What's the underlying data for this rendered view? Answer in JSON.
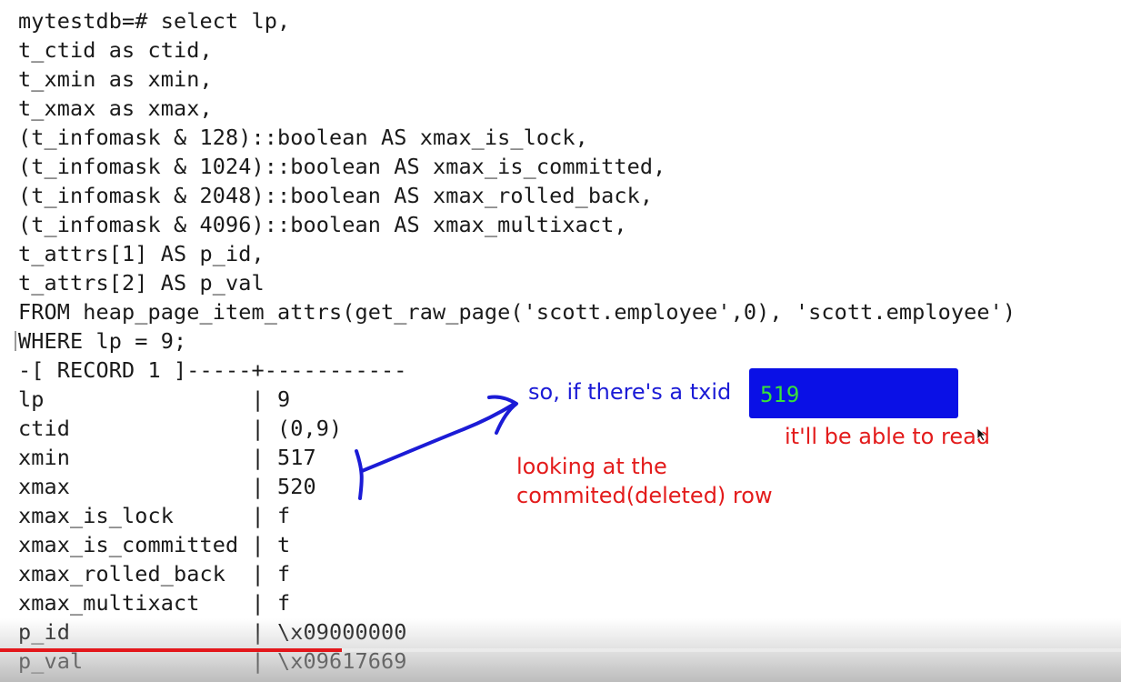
{
  "terminal": {
    "lines": [
      "mytestdb=# select lp,",
      "t_ctid as ctid,",
      "t_xmin as xmin,",
      "t_xmax as xmax,",
      "(t_infomask & 128)::boolean AS xmax_is_lock,",
      "(t_infomask & 1024)::boolean AS xmax_is_committed,",
      "(t_infomask & 2048)::boolean AS xmax_rolled_back,",
      "(t_infomask & 4096)::boolean AS xmax_multixact,",
      "t_attrs[1] AS p_id,",
      "t_attrs[2] AS p_val",
      "FROM heap_page_item_attrs(get_raw_page('scott.employee',0), 'scott.employee')",
      "WHERE lp = 9;",
      "-[ RECORD 1 ]-----+-----------",
      "lp                | 9",
      "ctid              | (0,9)",
      "xmin              | 517",
      "xmax              | 520",
      "xmax_is_lock      | f",
      "xmax_is_committed | t",
      "xmax_rolled_back  | f",
      "xmax_multixact    | f",
      "p_id              | \\x09000000",
      "p_val             | \\x09617669"
    ]
  },
  "annotations": {
    "txid_note": "so, if there's a txid",
    "highlight_value": "519",
    "read_note": "it'll be able to read",
    "row_note_line1": "looking at the",
    "row_note_line2": "commited(deleted) row"
  },
  "video": {
    "progress_fraction": 0.305
  },
  "colors": {
    "annotation_blue": "#1b1bd6",
    "annotation_red": "#e31b1b",
    "highlight_fill": "#0a10e6",
    "highlight_text": "#38e03a",
    "progress_red": "#e3171b"
  }
}
